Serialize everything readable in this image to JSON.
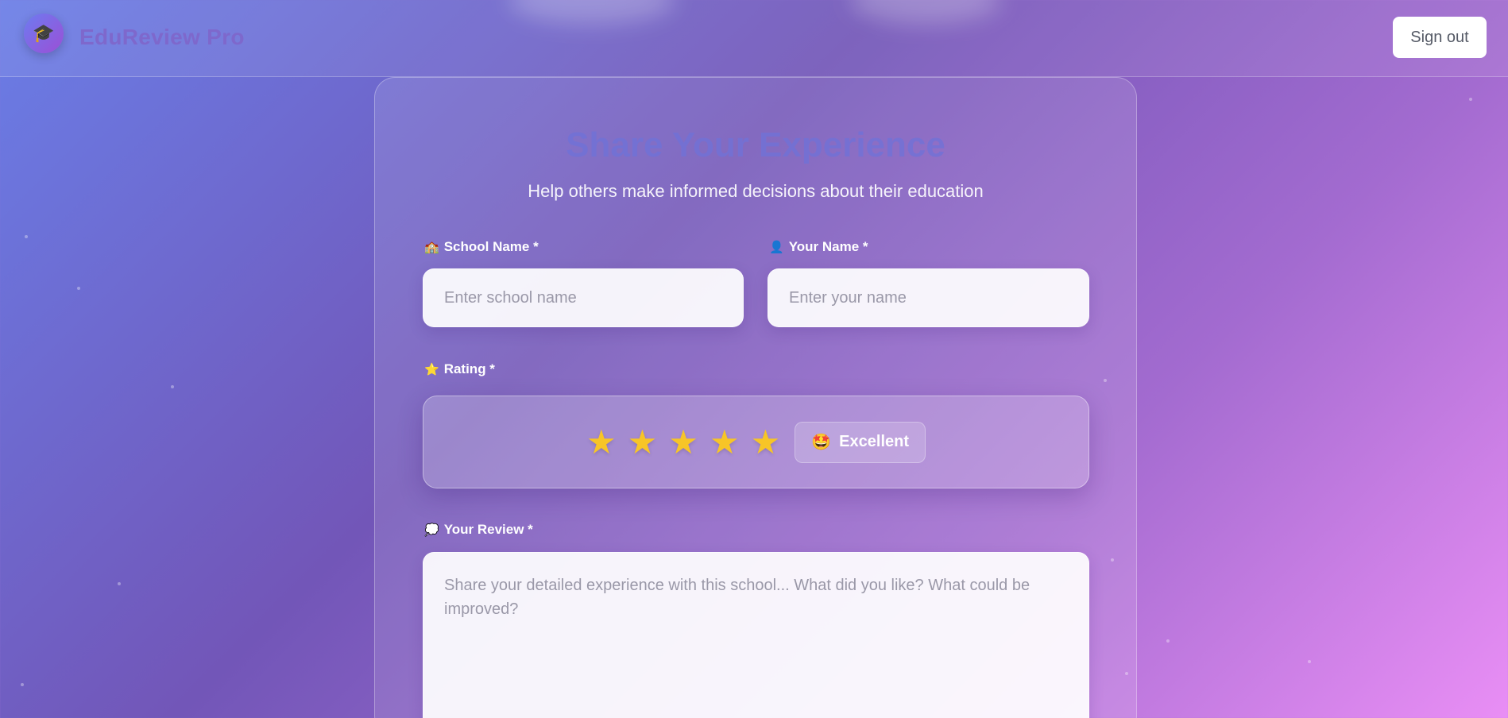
{
  "header": {
    "logo_icon": "graduation-cap-icon",
    "logo_glyph": "🎓",
    "brand": "EduReview Pro",
    "signout_label": "Sign out"
  },
  "form": {
    "title": "Share Your Experience",
    "subtitle": "Help others make informed decisions about their education",
    "school": {
      "icon": "school-icon",
      "glyph": "🏫",
      "label": "School Name *",
      "placeholder": "Enter school name",
      "value": ""
    },
    "name": {
      "icon": "person-icon",
      "glyph": "👤",
      "label": "Your Name *",
      "placeholder": "Enter your name",
      "value": ""
    },
    "rating": {
      "icon": "star-icon",
      "glyph": "⭐",
      "label": "Rating *",
      "value": 5,
      "max": 5,
      "star_glyph": "★",
      "badge_glyph": "🤩",
      "badge_icon": "star-struck-emoji-icon",
      "badge_text": "Excellent"
    },
    "review": {
      "icon": "speech-bubble-icon",
      "glyph": "💭",
      "label": "Your Review *",
      "placeholder": "Share your detailed experience with this school... What did you like? What could be improved?",
      "value": ""
    }
  },
  "colors": {
    "brand_text": "#7e68cc",
    "star": "#f7c527",
    "title": "#6f72d8"
  }
}
